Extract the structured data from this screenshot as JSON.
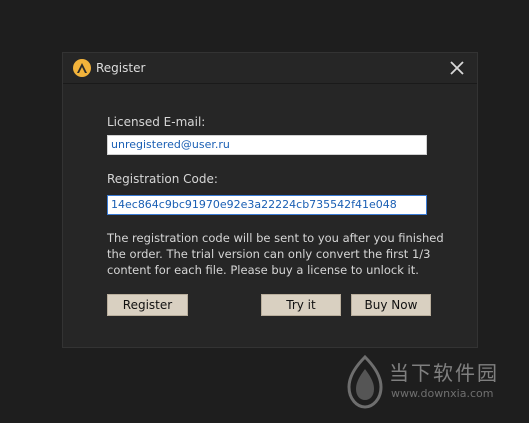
{
  "dialog": {
    "title": "Register",
    "email_label": "Licensed E-mail:",
    "email_value": "unregistered@user.ru",
    "code_label": "Registration Code:",
    "code_value": "14ec864c9bc91970e92e3a22224cb735542f41e048",
    "info_text": "The registration code will be sent to you after you finished the order. The trial version can only convert the first 1/3 content for each file. Please buy a license to unlock it.",
    "buttons": {
      "register": "Register",
      "try_it": "Try it",
      "buy_now": "Buy Now"
    }
  },
  "watermark": {
    "site_name": "当下软件园",
    "url": "www.downxia.com"
  },
  "colors": {
    "background": "#1e1e1e",
    "dialog": "#262626",
    "button": "#d9d0c1",
    "logo": "#f2b33b",
    "field_text": "#1a5fb4"
  },
  "icons": {
    "logo": "app-logo-icon",
    "close": "close-icon",
    "watermark": "downxia-logo-icon"
  }
}
